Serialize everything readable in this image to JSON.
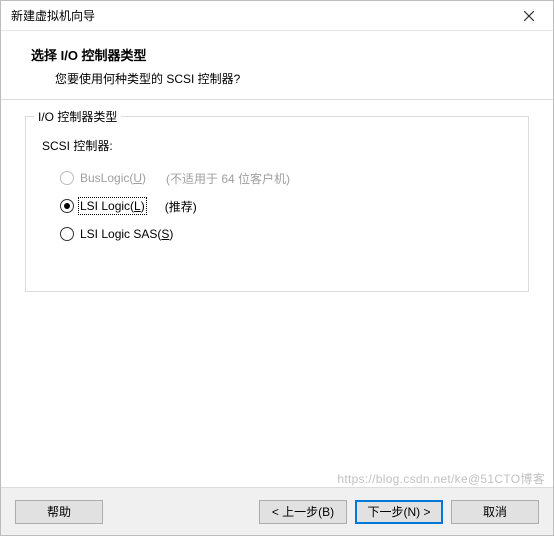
{
  "window": {
    "title": "新建虚拟机向导"
  },
  "header": {
    "title": "选择 I/O 控制器类型",
    "subtitle": "您要使用何种类型的 SCSI 控制器?"
  },
  "group": {
    "legend": "I/O 控制器类型",
    "scsi_label": "SCSI 控制器:",
    "options": [
      {
        "label_pre": "BusLogic(",
        "accel": "U",
        "label_post": ")",
        "note": "(不适用于 64 位客户机)",
        "selected": false,
        "disabled": true
      },
      {
        "label_pre": "LSI Logic(",
        "accel": "L",
        "label_post": ")",
        "note": "(推荐)",
        "selected": true,
        "disabled": false,
        "focused": true
      },
      {
        "label_pre": "LSI Logic SAS(",
        "accel": "S",
        "label_post": ")",
        "note": "",
        "selected": false,
        "disabled": false
      }
    ]
  },
  "buttons": {
    "help": "帮助",
    "back": "< 上一步(B)",
    "next": "下一步(N) >",
    "cancel": "取消"
  },
  "watermark": "https://blog.csdn.net/ke@51CTO博客"
}
